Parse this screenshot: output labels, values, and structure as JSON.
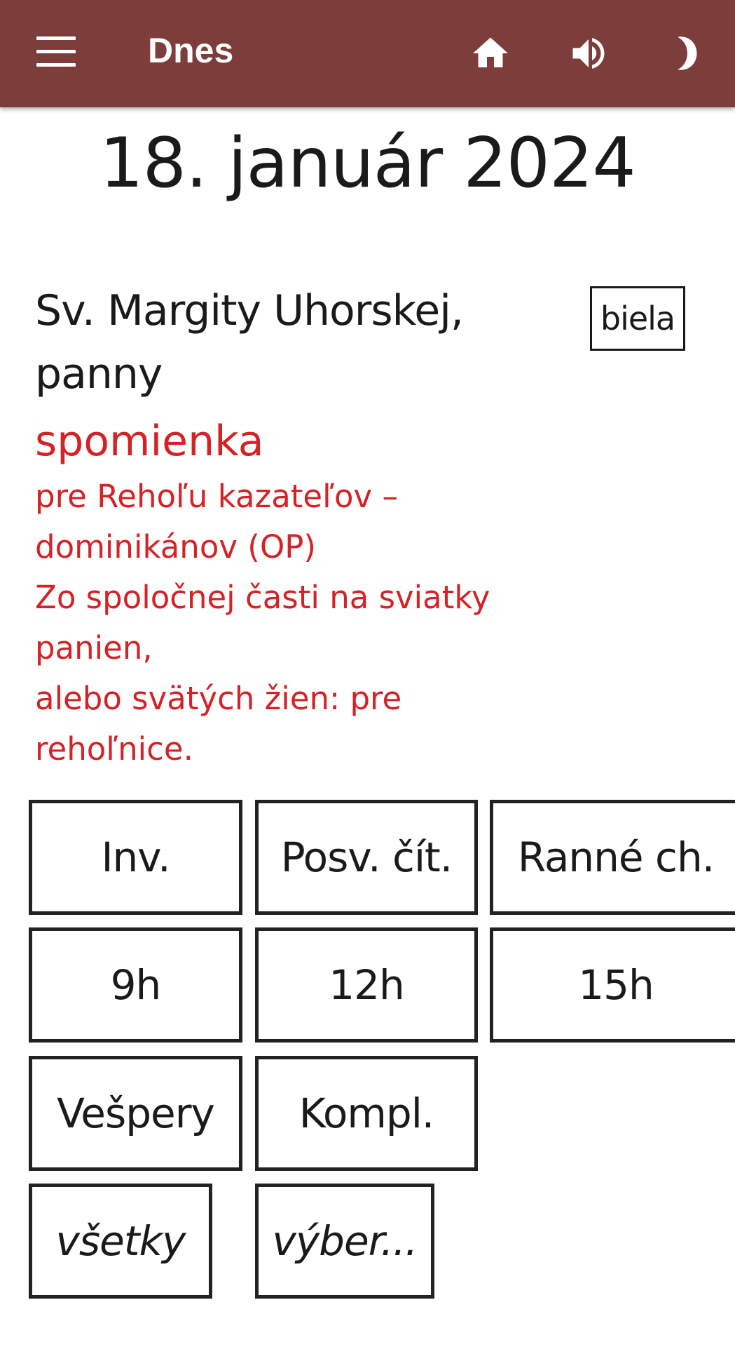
{
  "appbar": {
    "title": "Dnes",
    "background_color": "#7d3d3b",
    "icons": [
      "menu-icon",
      "home-icon",
      "volume-icon",
      "night-mode-icon"
    ]
  },
  "date": "18. január 2024",
  "celebration": {
    "title_line1": "Sv. Margity Uhorskej,",
    "title_line2": "panny",
    "color_label": "biela",
    "rank": "spomienka",
    "notes": [
      "pre Rehoľu kazateľov –",
      "dominikánov (OP)",
      "Zo spoločnej časti na sviatky",
      "panien,",
      "alebo svätých žien: pre",
      "rehoľnice."
    ],
    "red_color": "#d42226"
  },
  "hours": {
    "row1": [
      "Inv.",
      "Posv. čít.",
      "Ranné ch."
    ],
    "row2": [
      "9h",
      "12h",
      "15h"
    ],
    "row3": [
      "Vešpery",
      "Kompl."
    ],
    "row4": [
      "všetky",
      "výber..."
    ]
  }
}
